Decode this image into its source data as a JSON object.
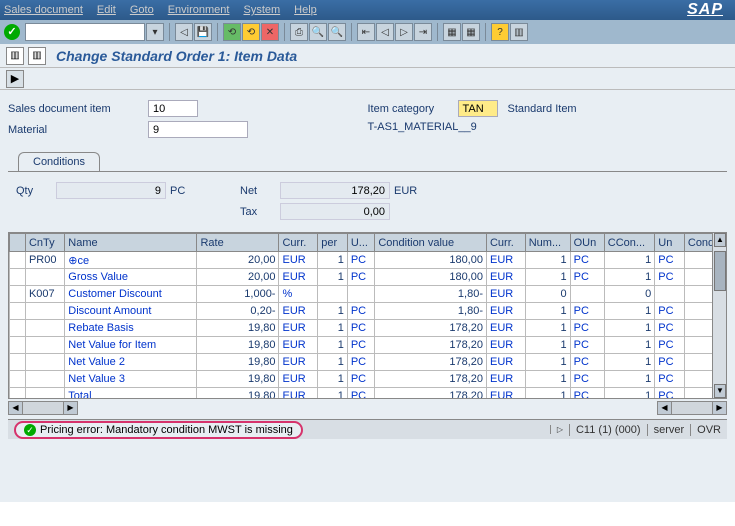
{
  "menu": [
    "Sales document",
    "Edit",
    "Goto",
    "Environment",
    "System",
    "Help"
  ],
  "sap": "SAP",
  "title": "Change Standard Order 1: Item Data",
  "header": {
    "item_label": "Sales document item",
    "item_value": "10",
    "cat_label": "Item category",
    "cat_value": "TAN",
    "cat_text": "Standard Item",
    "material_label": "Material",
    "material_value": "9",
    "material_text": "T-AS1_MATERIAL__9"
  },
  "tab": "Conditions",
  "summary": {
    "qty_label": "Qty",
    "qty_value": "9",
    "qty_unit": "PC",
    "net_label": "Net",
    "net_value": "178,20",
    "net_unit": "EUR",
    "tax_label": "Tax",
    "tax_value": "0,00"
  },
  "cols": [
    "",
    "CnTy",
    "Name",
    "Rate",
    "Curr.",
    "per",
    "U...",
    "Condition value",
    "Curr.",
    "Num...",
    "OUn",
    "CCon...",
    "Un",
    "Cond"
  ],
  "rows": [
    {
      "cnty": "PR00",
      "name": "⊕ce",
      "rate": "20,00",
      "c1": "EUR",
      "per": "1",
      "u": "PC",
      "cv": "180,00",
      "c2": "EUR",
      "n": "1",
      "o": "PC",
      "cc": "1",
      "un": "PC"
    },
    {
      "cnty": "",
      "name": "Gross Value",
      "rate": "20,00",
      "c1": "EUR",
      "per": "1",
      "u": "PC",
      "cv": "180,00",
      "c2": "EUR",
      "n": "1",
      "o": "PC",
      "cc": "1",
      "un": "PC"
    },
    {
      "cnty": "K007",
      "name": "Customer Discount",
      "rate": "1,000-",
      "c1": "%",
      "per": "",
      "u": "",
      "cv": "1,80-",
      "c2": "EUR",
      "n": "0",
      "o": "",
      "cc": "0",
      "un": ""
    },
    {
      "cnty": "",
      "name": "Discount Amount",
      "rate": "0,20-",
      "c1": "EUR",
      "per": "1",
      "u": "PC",
      "cv": "1,80-",
      "c2": "EUR",
      "n": "1",
      "o": "PC",
      "cc": "1",
      "un": "PC"
    },
    {
      "cnty": "",
      "name": "Rebate Basis",
      "rate": "19,80",
      "c1": "EUR",
      "per": "1",
      "u": "PC",
      "cv": "178,20",
      "c2": "EUR",
      "n": "1",
      "o": "PC",
      "cc": "1",
      "un": "PC"
    },
    {
      "cnty": "",
      "name": "Net Value for Item",
      "rate": "19,80",
      "c1": "EUR",
      "per": "1",
      "u": "PC",
      "cv": "178,20",
      "c2": "EUR",
      "n": "1",
      "o": "PC",
      "cc": "1",
      "un": "PC"
    },
    {
      "cnty": "",
      "name": "Net Value 2",
      "rate": "19,80",
      "c1": "EUR",
      "per": "1",
      "u": "PC",
      "cv": "178,20",
      "c2": "EUR",
      "n": "1",
      "o": "PC",
      "cc": "1",
      "un": "PC"
    },
    {
      "cnty": "",
      "name": "Net Value 3",
      "rate": "19,80",
      "c1": "EUR",
      "per": "1",
      "u": "PC",
      "cv": "178,20",
      "c2": "EUR",
      "n": "1",
      "o": "PC",
      "cc": "1",
      "un": "PC"
    },
    {
      "cnty": "",
      "name": "Total",
      "rate": "19,80",
      "c1": "EUR",
      "per": "1",
      "u": "PC",
      "cv": "178,20",
      "c2": "EUR",
      "n": "1",
      "o": "PC",
      "cc": "1",
      "un": "PC"
    }
  ],
  "status": {
    "msg": "Pricing error: Mandatory condition MWST is missing",
    "sys": "C11 (1) (000)",
    "srv": "server",
    "ovr": "OVR"
  }
}
